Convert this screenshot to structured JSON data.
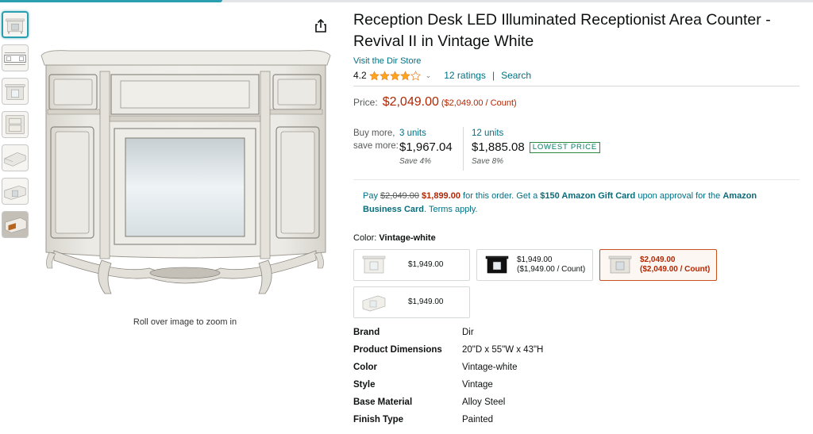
{
  "product": {
    "title": "Reception Desk LED Illuminated Receptionist Area Counter - Revival II in Vintage White",
    "store_link": "Visit the Dir Store",
    "rating_value": "4.2",
    "rating_stars": 4.2,
    "ratings_count": "12 ratings",
    "search_link": "Search",
    "separator": "|"
  },
  "gallery": {
    "zoom_caption": "Roll over image to zoom in",
    "thumbnails": [
      "desk-front",
      "desk-dimensions",
      "desk-light",
      "desk-detail",
      "desk-side",
      "desk-angle",
      "desk-drawer"
    ]
  },
  "price": {
    "label": "Price:",
    "amount": "$2,049.00",
    "per_unit": "($2,049.00 / Count)"
  },
  "tiers": {
    "label_line1": "Buy more,",
    "label_line2": "save more:",
    "items": [
      {
        "units": "3 units",
        "price": "$1,967.04",
        "save": "Save 4%"
      },
      {
        "units": "12 units",
        "price": "$1,885.08",
        "save": "Save 8%",
        "badge": "LOWEST PRICE"
      }
    ]
  },
  "business": {
    "pay_prefix": "Pay",
    "old_price": "$2,049.00",
    "new_price": "$1,899.00",
    "text1": "for this order. Get a",
    "gift": "$150 Amazon Gift Card",
    "text2": "upon approval for the",
    "card_line1": "Amazon",
    "card_line2": "Business Card",
    "terms": ". Terms apply."
  },
  "color": {
    "label": "Color:",
    "selected": "Vintage-white",
    "options": [
      {
        "price": "$1,949.00"
      },
      {
        "price": "$1,949.00",
        "per_unit": "($1,949.00 / Count)"
      },
      {
        "price": "$2,049.00",
        "per_unit": "($2,049.00 / Count)"
      },
      {
        "price": "$1,949.00"
      }
    ]
  },
  "specs": [
    {
      "key": "Brand",
      "value": "Dir"
    },
    {
      "key": "Product Dimensions",
      "value": "20\"D x 55\"W x 43\"H"
    },
    {
      "key": "Color",
      "value": "Vintage-white"
    },
    {
      "key": "Style",
      "value": "Vintage"
    },
    {
      "key": "Base Material",
      "value": "Alloy Steel"
    },
    {
      "key": "Finish Type",
      "value": "Painted"
    }
  ],
  "colors": {
    "link": "#007185",
    "price": "#b12704",
    "star": "#ffa41c",
    "accent": "#2a9fb1",
    "badge": "#067d62"
  }
}
